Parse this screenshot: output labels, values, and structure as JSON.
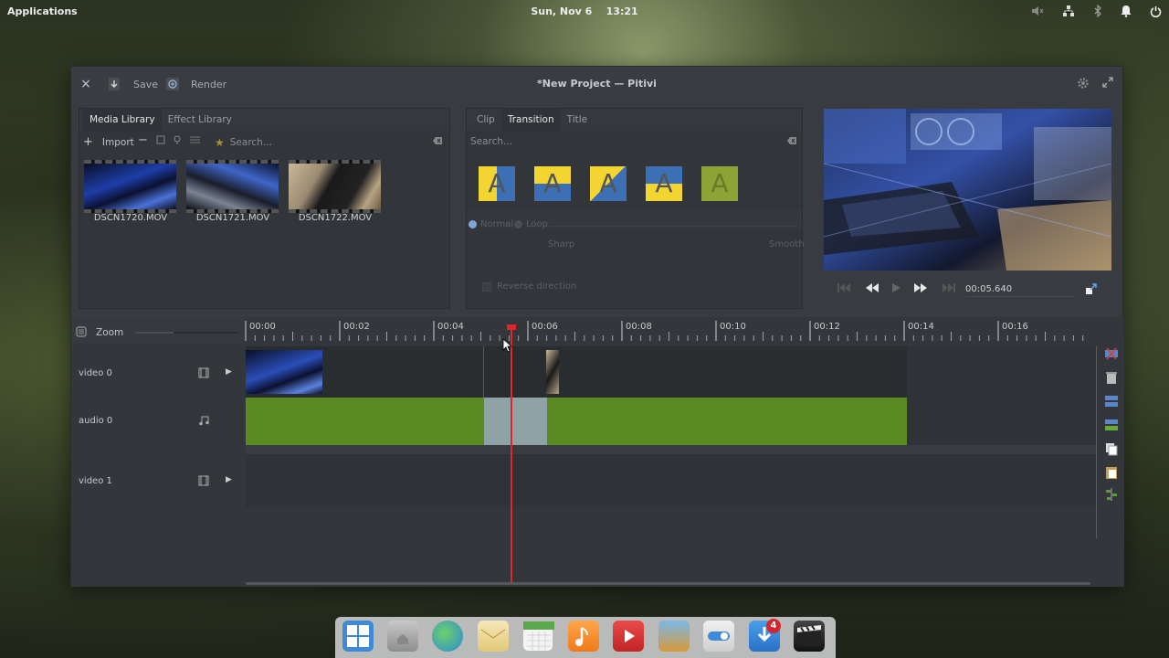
{
  "top_panel": {
    "applications": "Applications",
    "date": "Sun, Nov  6",
    "time": "13:21",
    "tray_icons": [
      "volume-muted-icon",
      "network-icon",
      "bluetooth-icon",
      "notifications-icon",
      "power-icon"
    ]
  },
  "window": {
    "title": "*New Project — Pitivi",
    "close": "×",
    "save_label": "Save",
    "render_label": "Render"
  },
  "media_panel": {
    "tabs": [
      "Media Library",
      "Effect Library"
    ],
    "active_tab": "Media Library",
    "import_label": "Import",
    "search_placeholder": "Search...",
    "clips": [
      {
        "name": "DSCN1720.MOV"
      },
      {
        "name": "DSCN1721.MOV"
      },
      {
        "name": "DSCN1722.MOV"
      }
    ]
  },
  "transition_panel": {
    "tabs": [
      "Clip",
      "Transition",
      "Title"
    ],
    "active_tab": "Transition",
    "search_placeholder": "Search...",
    "icons": [
      {
        "glyph": "A",
        "top": "#f2d531",
        "bottom": "#3d6fb5"
      },
      {
        "glyph": "A",
        "top": "#f2d531",
        "bottom": "#3d6fb5"
      },
      {
        "glyph": "A",
        "top": "#f2d531",
        "bottom": "#3d6fb5"
      },
      {
        "glyph": "A",
        "top": "#3d6fb5",
        "bottom": "#f2d531"
      },
      {
        "glyph": "A",
        "top": "#8fa236",
        "bottom": "#8fa236"
      }
    ],
    "normal_label": "Normal",
    "loop_label": "Loop",
    "sharp_label": "Sharp",
    "smooth_label": "Smooth",
    "reverse_label": "Reverse direction"
  },
  "viewer": {
    "timecode": "00:05.640"
  },
  "timeline": {
    "zoom_label": "Zoom",
    "ruler_labels": [
      "00:00",
      "00:02",
      "00:04",
      "00:06",
      "00:08",
      "00:10",
      "00:12",
      "00:14",
      "00:16"
    ],
    "playhead_time": "00:05.640",
    "layers": [
      {
        "video": "video 0",
        "audio": "audio 0"
      },
      {
        "video": "video 1"
      }
    ]
  },
  "dock": {
    "apps": [
      "multitasking-view-icon",
      "files-icon",
      "browser-icon",
      "mail-icon",
      "calendar-icon",
      "music-icon",
      "videos-icon",
      "photos-icon",
      "settings-icon",
      "appcenter-icon",
      "pitivi-icon"
    ],
    "appcenter_badge": "4"
  },
  "colors": {
    "audio_clip": "#5a8a22",
    "playhead": "#e0252b",
    "transition_overlay": "#8fa3a6"
  }
}
